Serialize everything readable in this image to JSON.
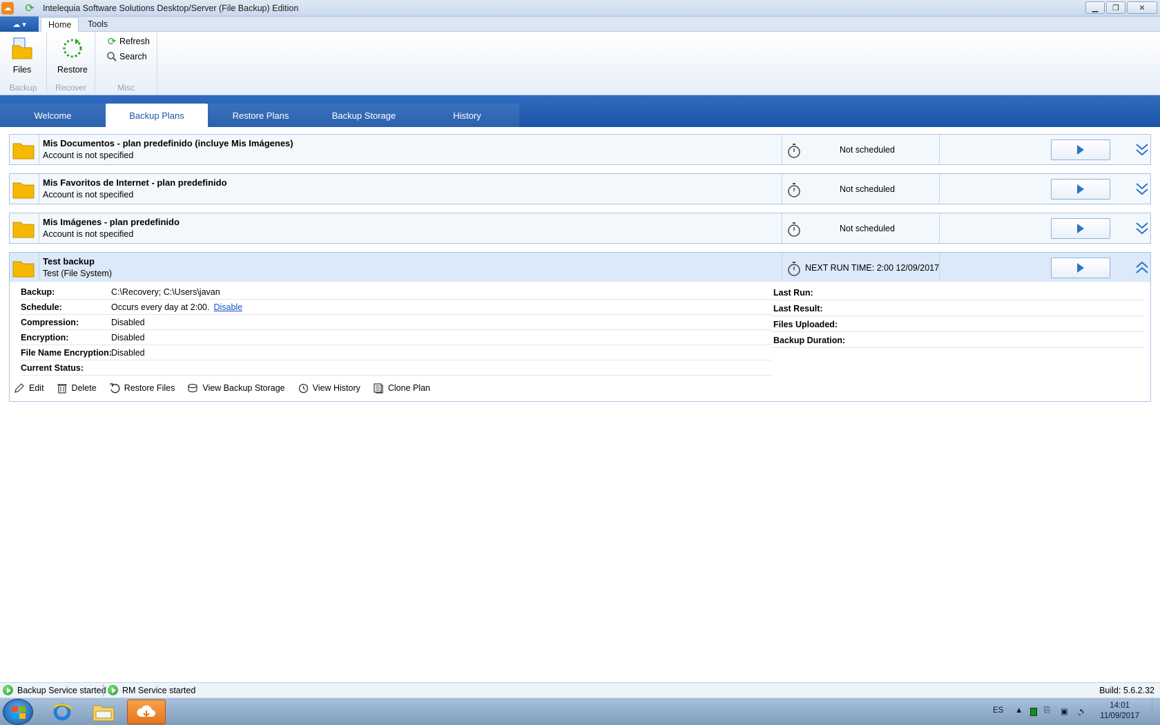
{
  "window": {
    "title": "Intelequia Software Solutions Desktop/Server (File Backup) Edition"
  },
  "ribbon": {
    "tabs": [
      {
        "label": "Home"
      },
      {
        "label": "Tools"
      }
    ],
    "groups": {
      "backup": {
        "label": "Backup",
        "files_label": "Files"
      },
      "recover": {
        "label": "Recover",
        "restore_label": "Restore"
      },
      "misc": {
        "label": "Misc",
        "refresh_label": "Refresh",
        "search_label": "Search"
      }
    }
  },
  "main_tabs": [
    {
      "label": "Welcome"
    },
    {
      "label": "Backup Plans"
    },
    {
      "label": "Restore Plans"
    },
    {
      "label": "Backup Storage"
    },
    {
      "label": "History"
    }
  ],
  "plans": [
    {
      "name": "Mis Documentos - plan predefinido (incluye Mis Imágenes)",
      "subtitle": "Account is not specified",
      "schedule": "Not scheduled"
    },
    {
      "name": "Mis Favoritos de Internet - plan predefinido",
      "subtitle": "Account is not specified",
      "schedule": "Not scheduled"
    },
    {
      "name": "Mis Imágenes - plan predefinido",
      "subtitle": "Account is not specified",
      "schedule": "Not scheduled"
    },
    {
      "name": "Test backup",
      "subtitle": "Test (File System)",
      "schedule": "NEXT RUN TIME: 2:00 12/09/2017"
    }
  ],
  "details": {
    "left": [
      {
        "key": "Backup:",
        "value": "C:\\Recovery; C:\\Users\\javan"
      },
      {
        "key": "Schedule:",
        "value": "Occurs every day at 2:00.",
        "link": "Disable"
      },
      {
        "key": "Compression:",
        "value": "Disabled"
      },
      {
        "key": "Encryption:",
        "value": "Disabled"
      },
      {
        "key": "File Name Encryption:",
        "value": "Disabled"
      },
      {
        "key": "Current Status:",
        "value": ""
      }
    ],
    "right": [
      {
        "key": "Last Run:"
      },
      {
        "key": "Last Result:"
      },
      {
        "key": "Files Uploaded:"
      },
      {
        "key": "Backup Duration:"
      }
    ],
    "actions": {
      "edit": "Edit",
      "delete": "Delete",
      "restore_files": "Restore Files",
      "view_backup_storage": "View Backup Storage",
      "view_history": "View History",
      "clone_plan": "Clone Plan"
    }
  },
  "statusbar": {
    "backup_service": "Backup Service started",
    "rm_service": "RM Service started",
    "build": "Build: 5.6.2.32"
  },
  "taskbar": {
    "language": "ES",
    "time": "14:01",
    "date": "11/09/2017"
  },
  "colors": {
    "accent_blue": "#1b54a6",
    "folder_yellow": "#f6b800",
    "status_green": "#1c9a1c"
  }
}
